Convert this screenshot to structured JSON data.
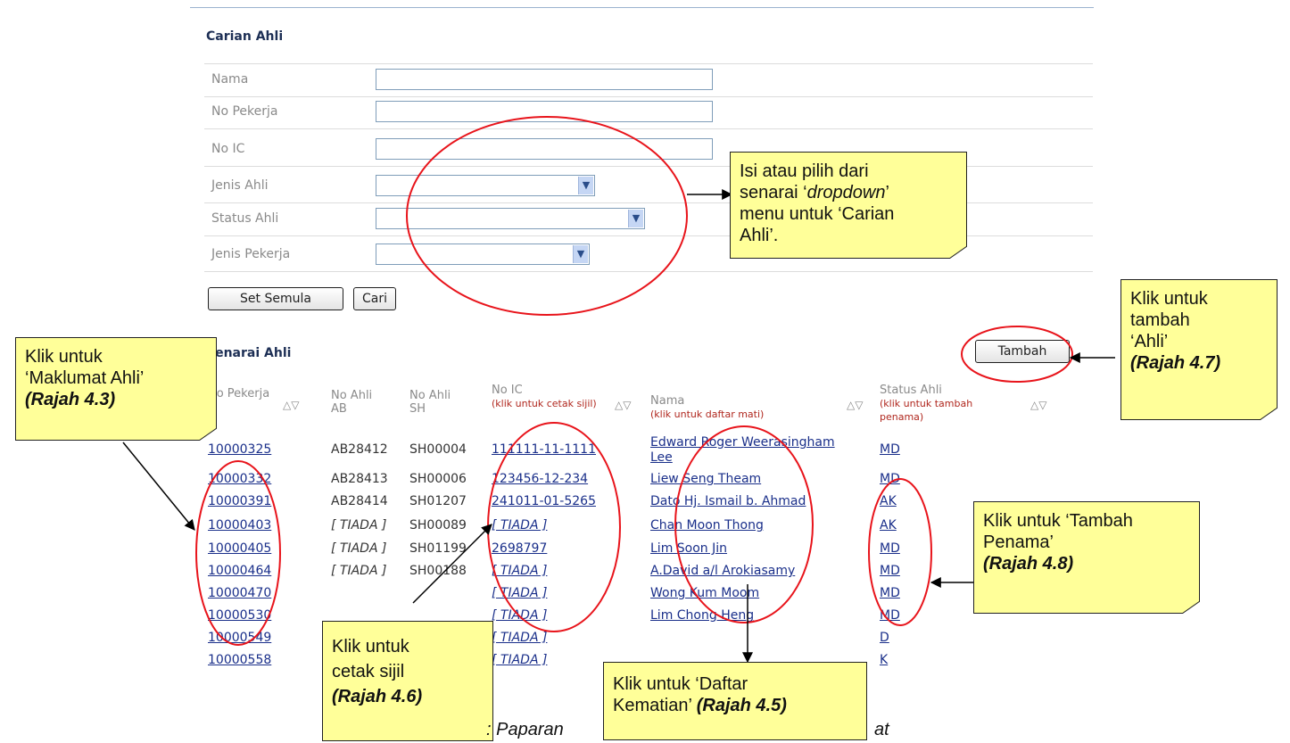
{
  "search": {
    "title": "Carian Ahli",
    "fields": [
      {
        "label": "Nama",
        "value": ""
      },
      {
        "label": "No Pekerja",
        "value": ""
      },
      {
        "label": "No IC",
        "value": ""
      },
      {
        "label": "Jenis Ahli",
        "value": ""
      },
      {
        "label": "Status Ahli",
        "value": ""
      },
      {
        "label": "Jenis Pekerja",
        "value": ""
      }
    ],
    "reset_label": "Set Semula",
    "search_label": "Cari"
  },
  "list": {
    "title": "Senarai Ahli",
    "add_label": "Tambah",
    "headers": {
      "no_pekerja": "No Pekerja",
      "no_ahli_ab": "No Ahli AB",
      "no_ahli_sh": "No Ahli SH",
      "no_ic": "No IC",
      "no_ic_sub": "(klik untuk cetak sijil)",
      "nama": "Nama",
      "nama_sub": "(klik untuk daftar mati)",
      "status": "Status Ahli",
      "status_sub": "(klik untuk tambah penama)"
    },
    "sort_icon": "sort-up-down-icon",
    "rows": [
      {
        "no_pekerja": "10000325",
        "ab": "AB28412",
        "sh": "SH00004",
        "ic": "111111-11-1111",
        "nama": "Edward Roger Weerasingham Lee",
        "status": "MD"
      },
      {
        "no_pekerja": "10000332",
        "ab": "AB28413",
        "sh": "SH00006",
        "ic": "123456-12-234",
        "nama": "Liew Seng Theam",
        "status": "MD"
      },
      {
        "no_pekerja": "10000391",
        "ab": "AB28414",
        "sh": "SH01207",
        "ic": "241011-01-5265",
        "nama": "Dato Hj. Ismail b. Ahmad",
        "status": "AK"
      },
      {
        "no_pekerja": "10000403",
        "ab": "[ TIADA ]",
        "sh": "SH00089",
        "ic": "[ TIADA ]",
        "nama": "Chan Moon Thong",
        "status": "AK"
      },
      {
        "no_pekerja": "10000405",
        "ab": "[ TIADA ]",
        "sh": "SH01199",
        "ic": "2698797",
        "nama": "Lim Soon Jin",
        "status": "MD"
      },
      {
        "no_pekerja": "10000464",
        "ab": "[ TIADA ]",
        "sh": "SH00188",
        "ic": "[ TIADA ]",
        "nama": "A.David a/l Arokiasamy",
        "status": "MD"
      },
      {
        "no_pekerja": "10000470",
        "ab": "",
        "sh": "",
        "ic": "[ TIADA ]",
        "nama": "Wong Kum Moom",
        "status": "MD"
      },
      {
        "no_pekerja": "10000530",
        "ab": "",
        "sh": "",
        "ic": "[ TIADA ]",
        "nama": "Lim Chong Heng",
        "status": "MD"
      },
      {
        "no_pekerja": "10000549",
        "ab": "",
        "sh": "",
        "ic": "[ TIADA ]",
        "nama": "",
        "status": "D"
      },
      {
        "no_pekerja": "10000558",
        "ab": "",
        "sh": "",
        "ic": "[ TIADA ]",
        "nama": "",
        "status": "K"
      }
    ]
  },
  "notes": {
    "dropdown": {
      "l1": "Isi atau pilih dari",
      "l2a": "senarai ‘",
      "l2b": "dropdown",
      "l2c": "’",
      "l3": "menu untuk ‘Carian",
      "l4": "Ahli’."
    },
    "tambah": {
      "l1": "Klik untuk",
      "l2": "tambah",
      "l3": "‘Ahli’",
      "l4": "(Rajah 4.7)"
    },
    "maklumat": {
      "l1": "Klik untuk",
      "l2": "‘Maklumat Ahli’",
      "l3": "(Rajah 4.3)"
    },
    "penama": {
      "l1": "Klik untuk ‘Tambah",
      "l2": "Penama’",
      "l3": "(Rajah 4.8)"
    },
    "sijil": {
      "l1": "Klik untuk",
      "l2": "cetak sijil",
      "l3": "(Rajah 4.6)"
    },
    "kematian": {
      "l1": "Klik untuk ‘Daftar",
      "l2a": "Kematian’ ",
      "l2b": "(Rajah 4.5)"
    }
  },
  "caption": {
    "a": ": Paparan",
    "b": "at"
  },
  "colors": {
    "note_fill": "#ffff99",
    "ellipse": "#e8141b",
    "link": "#1a2f8a",
    "header_sub": "#b0271e"
  }
}
